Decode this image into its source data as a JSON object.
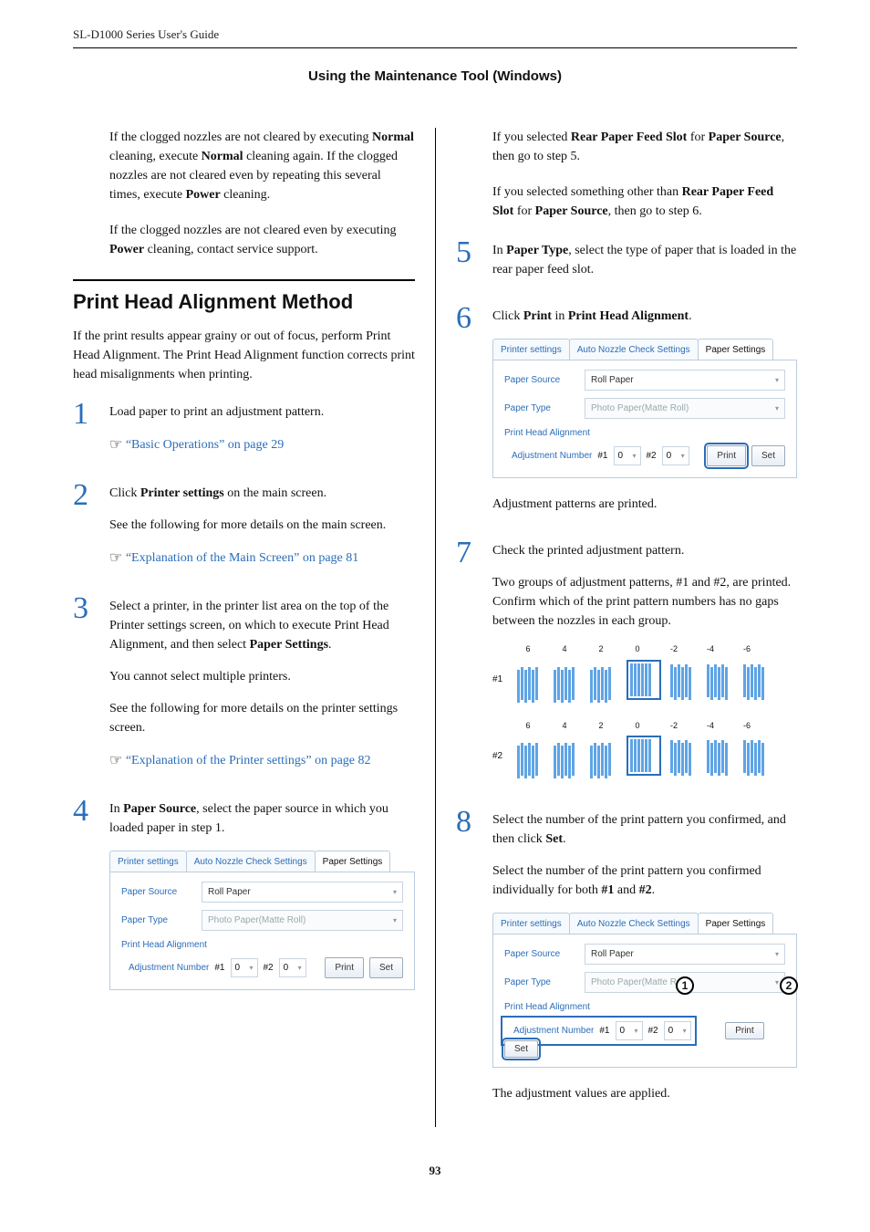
{
  "header": {
    "running": "SL-D1000 Series User's Guide",
    "section": "Using the Maintenance Tool (Windows)"
  },
  "left": {
    "para1": "If the clogged nozzles are not cleared by executing <b>Normal</b> cleaning, execute <b>Normal</b> cleaning again. If the clogged nozzles are not cleared even by repeating this several times, execute <b>Power</b> cleaning.",
    "para2": "If the clogged nozzles are not cleared even by executing <b>Power</b> cleaning, contact service support.",
    "heading": "Print Head Alignment Method",
    "intro": "If the print results appear grainy or out of focus, perform Print Head Alignment. The Print Head Alignment function corrects print head misalignments when printing.",
    "step1": {
      "num": "1",
      "text": "Load paper to print an adjustment pattern.",
      "link": "“Basic Operations” on page 29"
    },
    "step2": {
      "num": "2",
      "text1": "Click <b>Printer settings</b> on the main screen.",
      "text2": "See the following for more details on the main screen.",
      "link": "“Explanation of the Main Screen” on page 81"
    },
    "step3": {
      "num": "3",
      "text1": "Select a printer, in the printer list area on the top of the Printer settings screen, on which to execute Print Head Alignment, and then select <b>Paper Settings</b>.",
      "text2": "You cannot select multiple printers.",
      "text3": "See the following for more details on the printer settings screen.",
      "link": "“Explanation of the Printer settings” on page 82"
    },
    "step4": {
      "num": "4",
      "text": "In <b>Paper Source</b>, select the paper source in which you loaded paper in step 1."
    }
  },
  "right": {
    "pre5a": "If you selected <b>Rear Paper Feed Slot</b> for <b>Paper Source</b>, then go to step 5.",
    "pre5b": "If you selected something other than <b>Rear Paper Feed Slot</b> for <b>Paper Source</b>, then go to step 6.",
    "step5": {
      "num": "5",
      "text": "In <b>Paper Type</b>, select the type of paper that is loaded in the rear paper feed slot."
    },
    "step6": {
      "num": "6",
      "text": "Click <b>Print</b> in <b>Print Head Alignment</b>.",
      "after": "Adjustment patterns are printed."
    },
    "step7": {
      "num": "7",
      "text": "Check the printed adjustment pattern.",
      "after": "Two groups of adjustment patterns, #1 and #2, are printed. Confirm which of the print pattern numbers has no gaps between the nozzles in each group."
    },
    "step8": {
      "num": "8",
      "text": "Select the number of the print pattern you confirmed, and then click <b>Set</b>.",
      "after": "Select the number of the print pattern you confirmed individually for both <b>#1</b> and <b>#2</b>.",
      "after2": "The adjustment values are applied."
    }
  },
  "screenshot": {
    "tab1": "Printer settings",
    "tab2": "Auto Nozzle Check Settings",
    "tab3": "Paper Settings",
    "paper_source_label": "Paper Source",
    "paper_source_value": "Roll Paper",
    "paper_type_label": "Paper Type",
    "paper_type_value": "Photo Paper(Matte Roll)",
    "pha_label": "Print Head Alignment",
    "adj_label": "Adjustment Number",
    "hash1": "#1",
    "hash2": "#2",
    "val0": "0",
    "print_btn": "Print",
    "set_btn": "Set"
  },
  "pattern": {
    "cols": [
      "6",
      "4",
      "2",
      "0",
      "-2",
      "-4",
      "-6"
    ],
    "row1": "#1",
    "row2": "#2"
  },
  "badge": {
    "one": "1",
    "two": "2"
  },
  "page_number": "93"
}
